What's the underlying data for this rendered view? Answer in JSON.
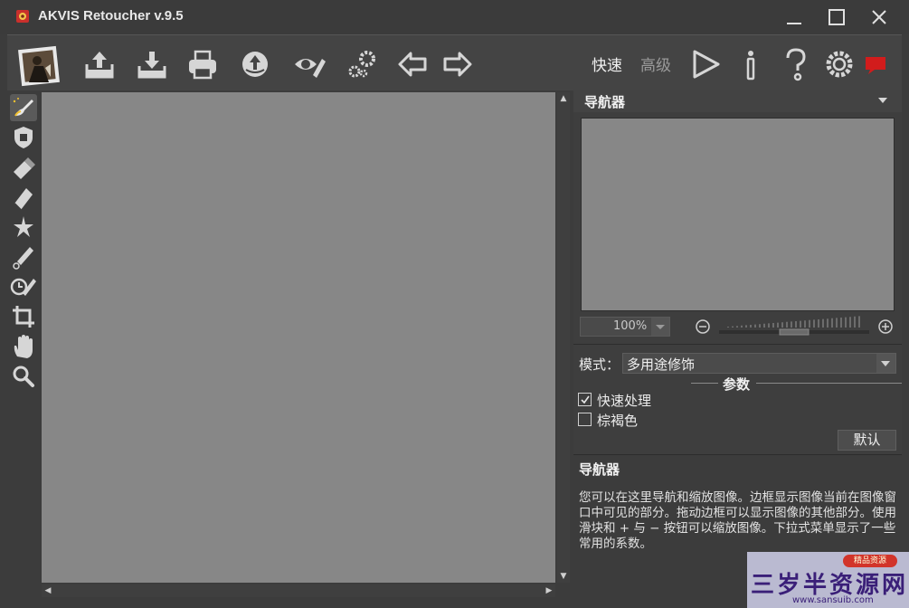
{
  "window": {
    "title": "AKVIS Retoucher v.9.5",
    "icon": "akvis-app-icon"
  },
  "toolbar": {
    "buttons": [
      {
        "name": "photo-thumbnail-icon"
      },
      {
        "name": "open-image-icon"
      },
      {
        "name": "save-image-icon"
      },
      {
        "name": "print-icon"
      },
      {
        "name": "share-icon"
      },
      {
        "name": "watermark-icon"
      },
      {
        "name": "batch-settings-icon"
      },
      {
        "name": "undo-icon"
      },
      {
        "name": "redo-icon"
      }
    ],
    "mode_quick": "快速",
    "mode_advanced": "高级",
    "right_buttons": [
      {
        "name": "run-icon"
      },
      {
        "name": "info-icon"
      },
      {
        "name": "help-icon"
      },
      {
        "name": "preferences-icon"
      },
      {
        "name": "news-icon"
      }
    ]
  },
  "tools": [
    {
      "name": "smart-brush-tool-icon",
      "active": true
    },
    {
      "name": "protect-tool-icon"
    },
    {
      "name": "eraser-tool-icon"
    },
    {
      "name": "stamp-tool-icon"
    },
    {
      "name": "magic-tool-icon"
    },
    {
      "name": "brush-tool-icon"
    },
    {
      "name": "history-brush-tool-icon"
    },
    {
      "name": "crop-tool-icon"
    },
    {
      "name": "hand-tool-icon"
    },
    {
      "name": "zoom-tool-icon"
    }
  ],
  "navigator": {
    "title": "导航器",
    "zoom": "100%"
  },
  "settings": {
    "mode_label": "模式：",
    "mode_value": "多用途修饰",
    "params_title": "参数",
    "checkboxes": [
      {
        "label": "快速处理",
        "checked": true
      },
      {
        "label": "棕褐色",
        "checked": false
      }
    ],
    "default_button": "默认"
  },
  "help": {
    "title": "导航器",
    "text": "您可以在这里导航和缩放图像。边框显示图像当前在图像窗口中可见的部分。拖动边框可以显示图像的其他部分。使用滑块和 + 与 − 按钮可以缩放图像。下拉式菜单显示了一些常用的系数。"
  },
  "watermark": {
    "badge": "精品资源",
    "text": "三岁半资源网",
    "url": "www.sansuib.com"
  },
  "colors": {
    "canvas": "#878787",
    "panel": "#3e3e3e",
    "accent_red": "#d21c1c"
  }
}
